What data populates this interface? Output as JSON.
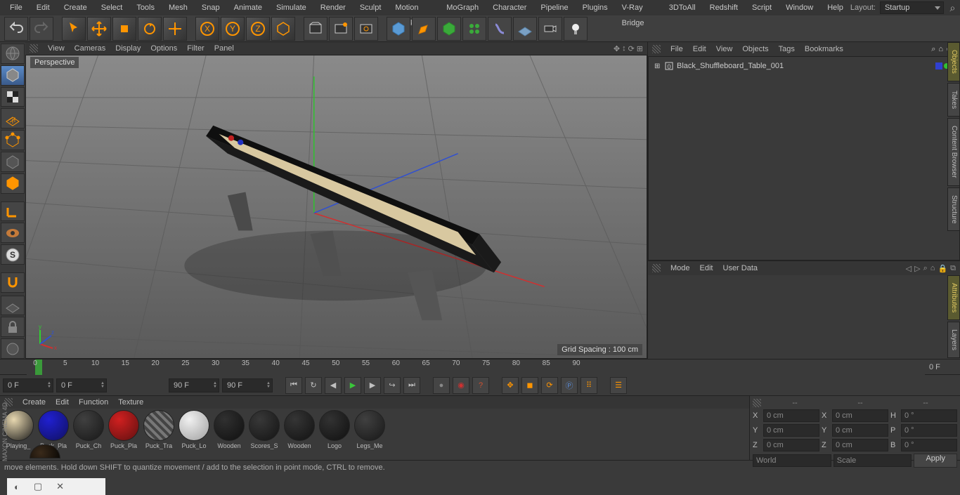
{
  "menu": {
    "file": "File",
    "edit": "Edit",
    "create": "Create",
    "select": "Select",
    "tools": "Tools",
    "mesh": "Mesh",
    "snap": "Snap",
    "animate": "Animate",
    "simulate": "Simulate",
    "render": "Render",
    "sculpt": "Sculpt",
    "motion": "Motion Tracker",
    "mograph": "MoGraph",
    "character": "Character",
    "pipeline": "Pipeline",
    "plugins": "Plugins",
    "vray": "V-Ray Bridge",
    "threed": "3DToAll",
    "redshift": "Redshift",
    "script": "Script",
    "window": "Window",
    "help": "Help",
    "layout_label": "Layout:",
    "layout_value": "Startup"
  },
  "vp_menu": {
    "view": "View",
    "cameras": "Cameras",
    "display": "Display",
    "options": "Options",
    "filter": "Filter",
    "panel": "Panel"
  },
  "viewport": {
    "label": "Perspective",
    "grid": "Grid Spacing : 100 cm"
  },
  "obj_menu": {
    "file": "File",
    "edit": "Edit",
    "view": "View",
    "objects": "Objects",
    "tags": "Tags",
    "bookmarks": "Bookmarks"
  },
  "object": {
    "name": "Black_Shuffleboard_Table_001"
  },
  "attr_menu": {
    "mode": "Mode",
    "edit": "Edit",
    "user": "User Data"
  },
  "side_tabs": {
    "objects": "Objects",
    "takes": "Takes",
    "content": "Content Browser",
    "structure": "Structure",
    "attributes": "Attributes",
    "layers": "Layers"
  },
  "timeline": {
    "frame_label": "0 F",
    "ticks": [
      "0",
      "5",
      "10",
      "15",
      "20",
      "25",
      "30",
      "35",
      "40",
      "45",
      "50",
      "55",
      "60",
      "65",
      "70",
      "75",
      "80",
      "85",
      "90"
    ]
  },
  "controls": {
    "start": "0 F",
    "loop_start": "0 F",
    "loop_end": "90 F",
    "end": "90 F"
  },
  "mat_menu": {
    "create": "Create",
    "edit": "Edit",
    "function": "Function",
    "texture": "Texture"
  },
  "materials": [
    {
      "name": "Playing_",
      "color1": "#e8d8b0",
      "color2": "#1a1a1a"
    },
    {
      "name": "Puck_Pla",
      "color1": "#2020d0",
      "color2": "#101060"
    },
    {
      "name": "Puck_Ch",
      "color1": "#404040",
      "color2": "#181818"
    },
    {
      "name": "Puck_Pla",
      "color1": "#d02020",
      "color2": "#601010"
    },
    {
      "name": "Puck_Tra",
      "color1": "#505050",
      "color2": "#202020",
      "striped": true
    },
    {
      "name": "Puck_Lo",
      "color1": "#f0f0f0",
      "color2": "#a0a0a0"
    },
    {
      "name": "Wooden",
      "color1": "#303030",
      "color2": "#101010"
    },
    {
      "name": "Scores_S",
      "color1": "#383838",
      "color2": "#141414"
    },
    {
      "name": "Wooden",
      "color1": "#353535",
      "color2": "#121212"
    },
    {
      "name": "Logo",
      "color1": "#323232",
      "color2": "#101010"
    },
    {
      "name": "Legs_Me",
      "color1": "#404040",
      "color2": "#181818"
    }
  ],
  "coords": {
    "x": "X",
    "y": "Y",
    "z": "Z",
    "xv": "0 cm",
    "yv": "0 cm",
    "zv": "0 cm",
    "h": "H",
    "p": "P",
    "b": "B",
    "hv": "0 °",
    "pv": "0 °",
    "bv": "0 °",
    "world": "World",
    "scale": "Scale",
    "apply": "Apply",
    "dash": "--"
  },
  "status": "move elements. Hold down SHIFT to quantize movement / add to the selection in point mode, CTRL to remove.",
  "brand": "MAXON CINEMA 4D"
}
